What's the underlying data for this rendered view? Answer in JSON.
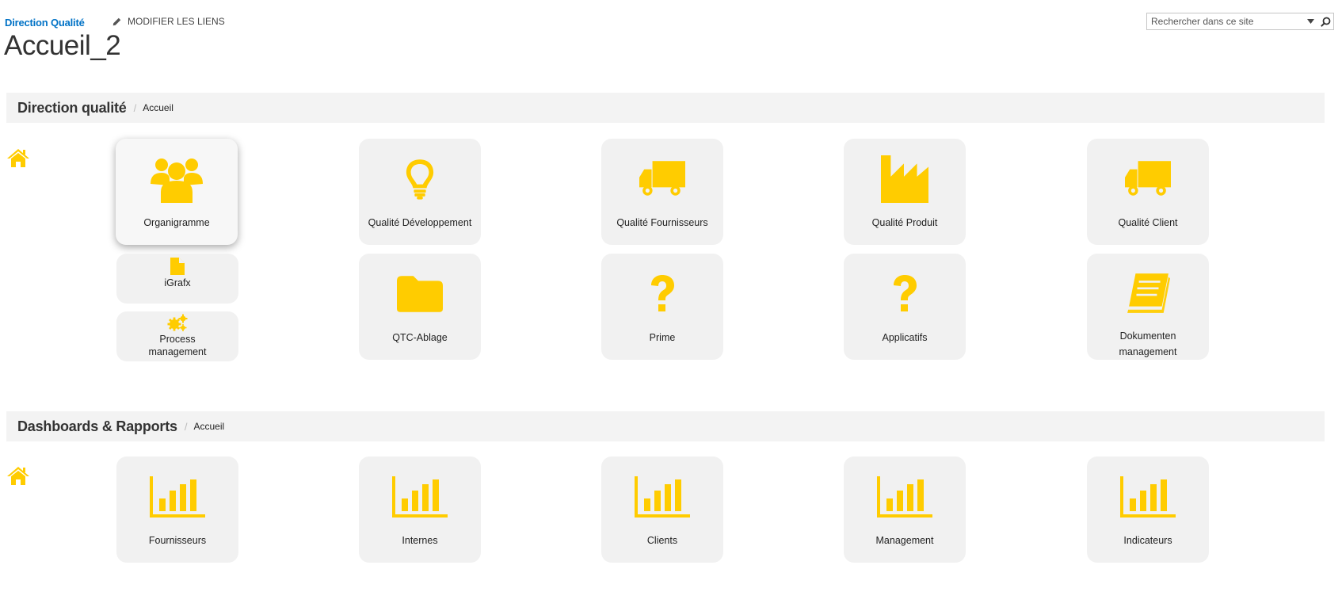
{
  "header": {
    "site_link": "Direction Qualité",
    "edit_links_label": "MODIFIER LES LIENS",
    "page_title": "Accueil_2",
    "search_placeholder": "Rechercher dans ce site"
  },
  "sections": [
    {
      "title": "Direction qualité",
      "crumb": "Accueil",
      "tiles": [
        {
          "label": "Organigramme",
          "icon": "people-group-icon"
        },
        {
          "label": "Qualité Développement",
          "icon": "lightbulb-icon"
        },
        {
          "label": "Qualité Fournisseurs",
          "icon": "truck-icon"
        },
        {
          "label": "Qualité Produit",
          "icon": "factory-icon"
        },
        {
          "label": "Qualité Client",
          "icon": "truck-icon"
        },
        {
          "label": "iGrafx",
          "icon": "file-icon"
        },
        {
          "label": "QTC-Ablage",
          "icon": "folder-icon"
        },
        {
          "label": "Prime",
          "icon": "question-icon"
        },
        {
          "label": "Applicatifs",
          "icon": "question-icon"
        },
        {
          "label": "Dokumenten management",
          "icon": "book-icon"
        },
        {
          "label": "Process management",
          "icon": "gears-icon"
        }
      ]
    },
    {
      "title": "Dashboards & Rapports",
      "crumb": "Accueil",
      "tiles": [
        {
          "label": "Fournisseurs",
          "icon": "bar-chart-icon"
        },
        {
          "label": "Internes",
          "icon": "bar-chart-icon"
        },
        {
          "label": "Clients",
          "icon": "bar-chart-icon"
        },
        {
          "label": "Management",
          "icon": "bar-chart-icon"
        },
        {
          "label": "Indicateurs",
          "icon": "bar-chart-icon"
        }
      ]
    }
  ],
  "colors": {
    "accent": "#ffcc00",
    "link": "#0072c6",
    "tile_bg": "#f1f1f1",
    "header_bg": "#f3f3f3"
  }
}
